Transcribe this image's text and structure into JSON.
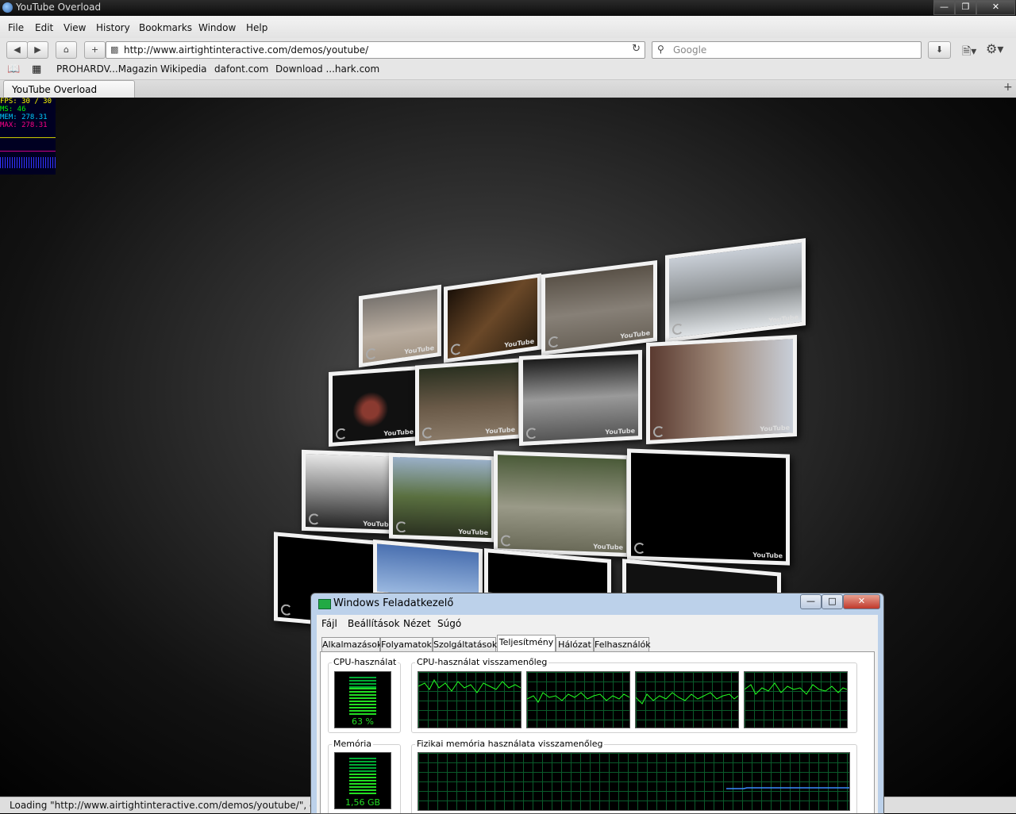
{
  "window": {
    "title": "YouTube Overload"
  },
  "menu": [
    "File",
    "Edit",
    "View",
    "History",
    "Bookmarks",
    "Window",
    "Help"
  ],
  "nav": {
    "url": "http://www.airtightinteractive.com/demos/youtube/",
    "search_placeholder": "Google"
  },
  "bookmarks": [
    "PROHARDV...Magazin",
    "Wikipedia",
    "dafont.com",
    "Download ...hark.com"
  ],
  "tab": {
    "label": "YouTube Overload"
  },
  "fps": {
    "fps": "FPS: 30 / 30",
    "ms": "MS: 46",
    "mem": "MEM: 278.31",
    "max": "MAX: 278.31"
  },
  "tiles": {
    "logo": "YouTube"
  },
  "status": {
    "text": "Loading \"http://www.airtightinteractive.com/demos/youtube/\", compl"
  },
  "taskmgr": {
    "title": "Windows Feladatkezelő",
    "menu": [
      "Fájl",
      "Beállítások",
      "Nézet",
      "Súgó"
    ],
    "tabs": [
      "Alkalmazások",
      "Folyamatok",
      "Szolgáltatások",
      "Teljesítmény",
      "Hálózat",
      "Felhasználók"
    ],
    "cpu_label": "CPU-használat",
    "cpu_value": "63 %",
    "cpu_history_label": "CPU-használat visszamenőleg",
    "mem_label": "Memória",
    "mem_value": "1,56 GB",
    "mem_history_label": "Fizikai memória használata visszamenőleg"
  },
  "colors": {
    "gauge_green": "#22dd22",
    "graph_grid": "#0a5a2a",
    "mem_line": "#3a8aff"
  }
}
